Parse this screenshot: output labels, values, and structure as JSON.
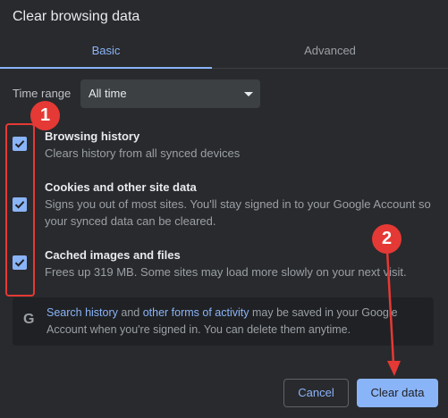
{
  "dialog": {
    "title": "Clear browsing data"
  },
  "tabs": [
    {
      "label": "Basic",
      "selected": true
    },
    {
      "label": "Advanced",
      "selected": false
    }
  ],
  "time_range": {
    "label": "Time range",
    "value": "All time"
  },
  "options": [
    {
      "title": "Browsing history",
      "description": "Clears history from all synced devices",
      "checked": true
    },
    {
      "title": "Cookies and other site data",
      "description": "Signs you out of most sites. You'll stay signed in to your Google Account so your synced data can be cleared.",
      "checked": true
    },
    {
      "title": "Cached images and files",
      "description": "Frees up 319 MB. Some sites may load more slowly on your next visit.",
      "checked": true
    }
  ],
  "info": {
    "icon": "google-g-icon",
    "link1": "Search history",
    "text_and": " and ",
    "link2": "other forms of activity",
    "text_rest": " may be saved in your Google Account when you're signed in. You can delete them anytime."
  },
  "buttons": {
    "cancel": "Cancel",
    "clear": "Clear data"
  },
  "annotations": {
    "badge1": "1",
    "badge2": "2",
    "color": "#e53935"
  },
  "colors": {
    "accent": "#8ab4f8",
    "background": "#292a2d"
  }
}
